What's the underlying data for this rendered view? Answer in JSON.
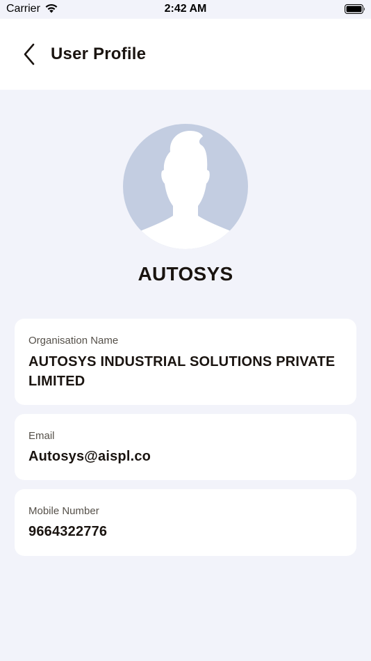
{
  "status_bar": {
    "carrier": "Carrier",
    "time": "2:42 AM",
    "wifi_icon": "wifi-icon",
    "battery_icon": "battery-icon"
  },
  "header": {
    "title": "User Profile",
    "back_icon": "chevron-left-icon"
  },
  "profile": {
    "avatar_icon": "default-avatar-silhouette",
    "name": "AUTOSYS"
  },
  "details": {
    "organisation": {
      "label": "Organisation Name",
      "value": "AUTOSYS INDUSTRIAL SOLUTIONS PRIVATE LIMITED"
    },
    "email": {
      "label": "Email",
      "value": "Autosys@aispl.co"
    },
    "mobile": {
      "label": "Mobile Number",
      "value": "9664322776"
    }
  },
  "colors": {
    "background": "#f2f3fa",
    "card": "#ffffff",
    "text_primary": "#1a1410",
    "text_secondary": "#555049",
    "avatar_fill": "#c3cde1"
  }
}
